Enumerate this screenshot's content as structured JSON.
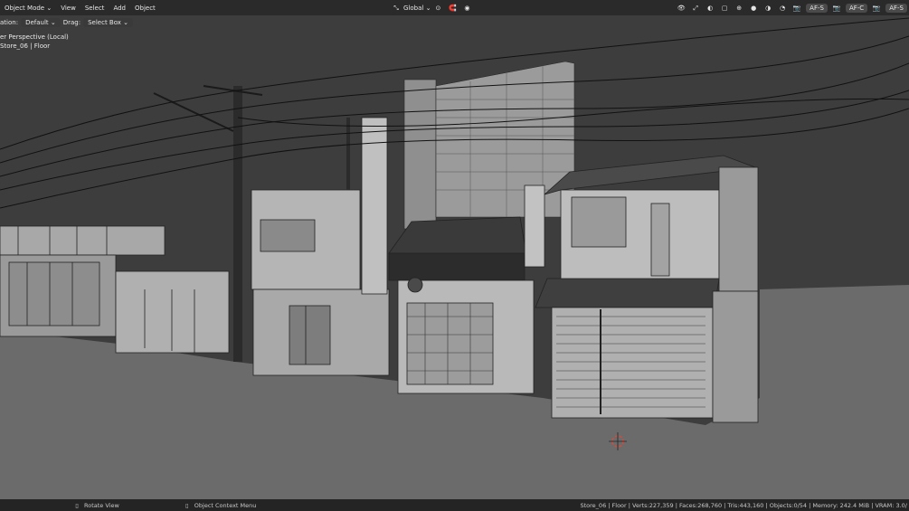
{
  "header": {
    "mode": "Object Mode",
    "menus": [
      "View",
      "Select",
      "Add",
      "Object"
    ],
    "transform_orientation": "Global",
    "right_badges": [
      "AF-S",
      "AF-C",
      "AF-S"
    ]
  },
  "toolbar": {
    "orientation_label": "ation:",
    "orientation_value": "Default",
    "drag_label": "Drag:",
    "drag_value": "Select Box"
  },
  "viewport": {
    "perspective_label": "er Perspective (Local)",
    "object_label": "Store_06 | Floor"
  },
  "statusbar": {
    "rotate_view": "Rotate View",
    "context_menu": "Object Context Menu",
    "stats": "Store_06 | Floor | Verts:227,359 | Faces:268,760 | Tris:443,160 | Objects:0/54 | Memory: 242.4 MiB | VRAM: 3.0/"
  },
  "colors": {
    "sky": "#3d3d3d",
    "ground": "#6a6a6a",
    "building": "#a5a5a5",
    "wire": "#111111",
    "cursor": "#d84a3a"
  },
  "icons": [
    "select-icon",
    "link-icon",
    "snap-icon",
    "proportional-icon",
    "overlay-icon",
    "gizmo-icon",
    "shading-icon",
    "camera-icon"
  ]
}
